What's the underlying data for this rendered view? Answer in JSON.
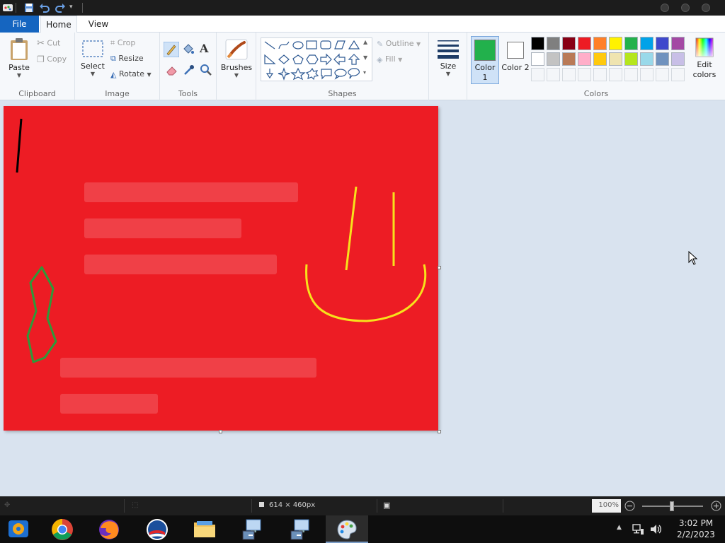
{
  "ribbon": {
    "tabs": {
      "file": "File",
      "home": "Home",
      "view": "View"
    },
    "clipboard": {
      "label": "Clipboard",
      "paste": "Paste",
      "cut": "Cut",
      "copy": "Copy"
    },
    "image": {
      "label": "Image",
      "select": "Select",
      "crop": "Crop",
      "resize": "Resize",
      "rotate": "Rotate"
    },
    "tools": {
      "label": "Tools"
    },
    "brushes": {
      "label": "Brushes"
    },
    "shapes": {
      "label": "Shapes",
      "outline": "Outline",
      "fill": "Fill"
    },
    "size": {
      "label": "Size"
    },
    "colors": {
      "label": "Colors",
      "color1": "Color 1",
      "color2": "Color 2",
      "edit": "Edit colors",
      "color1_value": "#22b14c",
      "color2_value": "#ffffff",
      "row1": [
        "#000000",
        "#7f7f7f",
        "#880015",
        "#ed1c24",
        "#ff7f27",
        "#fff200",
        "#22b14c",
        "#00a2e8",
        "#3f48cc",
        "#a349a4"
      ],
      "row2": [
        "#ffffff",
        "#c3c3c3",
        "#b97a57",
        "#ffaec9",
        "#ffc90e",
        "#efe4b0",
        "#b5e61d",
        "#99d9ea",
        "#7092be",
        "#c8bfe7"
      ]
    }
  },
  "canvas": {
    "background": "#ed1c24"
  },
  "status": {
    "dimensions": "614 × 460px",
    "zoom": "100%"
  },
  "taskbar": {
    "time": "3:02 PM",
    "date": "2/2/2023"
  }
}
